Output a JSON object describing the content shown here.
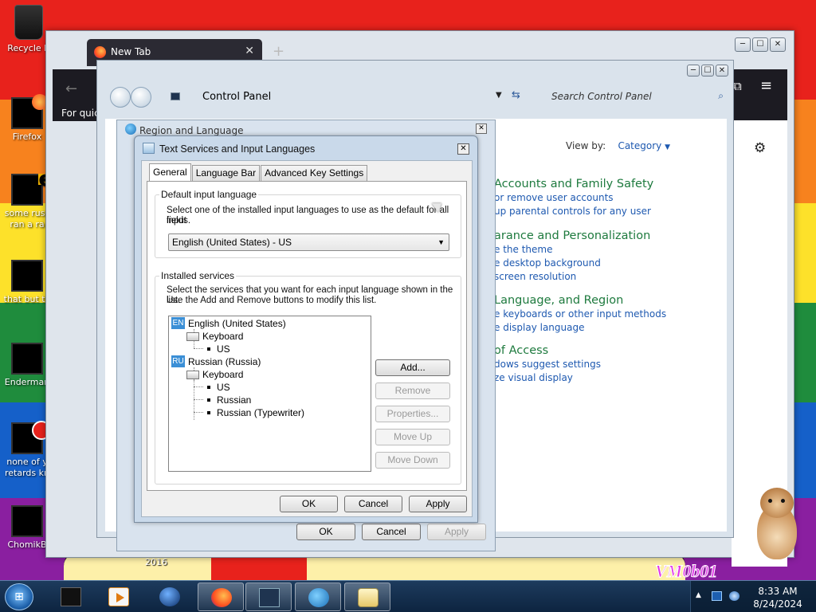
{
  "desktop": {
    "icons": [
      {
        "label": "Recycle B"
      },
      {
        "label": "Firefox"
      },
      {
        "label": "some russ ran a ra"
      },
      {
        "label": "that but ta"
      },
      {
        "label": "Enderman"
      },
      {
        "label": "none of y retards kn"
      },
      {
        "label": "ChomikB"
      }
    ],
    "wallpaper_text_year": "2016",
    "wallpaper_text_logo": "VM0b01"
  },
  "browser": {
    "tab_title": "New Tab",
    "quick_text": "For quick"
  },
  "control_panel": {
    "breadcrumb": "Control Panel",
    "search_placeholder": "Search Control Panel",
    "view_by_label": "View by:",
    "view_by_value": "Category",
    "categories": [
      {
        "title": "Accounts and Family Safety",
        "links": [
          "or remove user accounts",
          "up parental controls for any user"
        ]
      },
      {
        "title": "arance and Personalization",
        "links": [
          "e the theme",
          "e desktop background",
          "screen resolution"
        ]
      },
      {
        "title": "Language, and Region",
        "links": [
          "e keyboards or other input methods",
          "e display language"
        ]
      },
      {
        "title": "of Access",
        "links": [
          "dows suggest settings",
          "ze visual display"
        ]
      }
    ]
  },
  "region": {
    "title": "Region and Language",
    "buttons": {
      "ok": "OK",
      "cancel": "Cancel",
      "apply": "Apply"
    }
  },
  "text_services": {
    "title": "Text Services and Input Languages",
    "tabs": [
      "General",
      "Language Bar",
      "Advanced Key Settings"
    ],
    "default_group": {
      "label": "Default input language",
      "desc_line1": "Select one of the installed input languages to use as the default for all input",
      "desc_line2": "fields.",
      "selected": "English (United States) - US"
    },
    "installed_group": {
      "label": "Installed services",
      "desc_line1": "Select the services that you want for each input language shown in the list.",
      "desc_line2": "Use the Add and Remove buttons to modify this list."
    },
    "tree": {
      "lang1": {
        "code": "EN",
        "name": "English (United States)",
        "group": "Keyboard",
        "items": [
          "US"
        ]
      },
      "lang2": {
        "code": "RU",
        "name": "Russian (Russia)",
        "group": "Keyboard",
        "items": [
          "US",
          "Russian",
          "Russian (Typewriter)"
        ]
      }
    },
    "side_buttons": {
      "add": "Add...",
      "remove": "Remove",
      "properties": "Properties...",
      "move_up": "Move Up",
      "move_down": "Move Down"
    },
    "bottom_buttons": {
      "ok": "OK",
      "cancel": "Cancel",
      "apply": "Apply"
    }
  },
  "taskbar": {
    "time": "8:33 AM",
    "date": "8/24/2024"
  },
  "icons": {
    "start": "windows-logo-icon",
    "search": "magnifier-icon",
    "settings": "gear-icon"
  },
  "colors": {
    "accent_link": "#1e59b0",
    "category_green": "#1e7a3e",
    "taskbar": "#1d3b5d"
  }
}
